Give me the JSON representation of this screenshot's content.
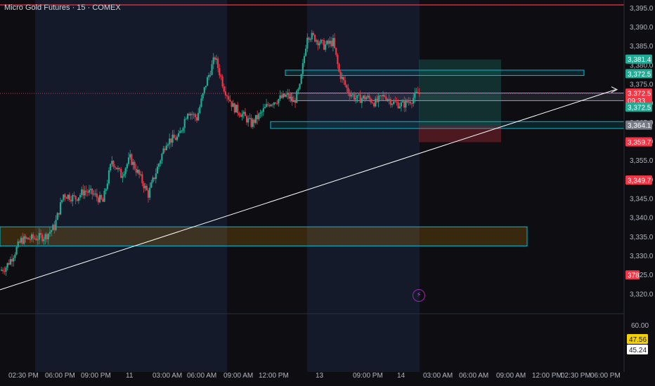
{
  "header": {
    "title": "Micro Gold Futures · 15 · COMEX"
  },
  "chart_data": {
    "type": "candlestick",
    "symbol": "Micro Gold Futures",
    "interval": "15",
    "exchange": "COMEX",
    "ylim": [
      3316,
      3397
    ],
    "y_ticks": [
      3320,
      3325,
      3330,
      3335,
      3340,
      3345,
      3350,
      3355,
      3360,
      3365,
      3370,
      3375,
      3380,
      3385,
      3390,
      3395
    ],
    "x_tick_labels": [
      "02:30 PM",
      "06:00 PM",
      "09:00 PM",
      "11",
      "03:00 AM",
      "06:00 AM",
      "09:00 AM",
      "12:00 PM",
      "13",
      "09:00 PM",
      "14",
      "03:00 AM",
      "06:00 AM",
      "09:00 AM",
      "12:00 PM",
      "02:30 PM",
      "06:00 PM"
    ],
    "price_path": [
      [
        0,
        3326.0
      ],
      [
        4,
        3327.0
      ],
      [
        8,
        3329.5
      ],
      [
        14,
        3334.0
      ],
      [
        22,
        3334.5
      ],
      [
        30,
        3335.0
      ],
      [
        36,
        3337.5
      ],
      [
        42,
        3346.0
      ],
      [
        50,
        3345.0
      ],
      [
        56,
        3347.0
      ],
      [
        62,
        3346.0
      ],
      [
        68,
        3344.0
      ],
      [
        74,
        3355.0
      ],
      [
        80,
        3351.0
      ],
      [
        86,
        3355.5
      ],
      [
        92,
        3351.0
      ],
      [
        98,
        3346.0
      ],
      [
        104,
        3353.0
      ],
      [
        110,
        3360.0
      ],
      [
        118,
        3361.0
      ],
      [
        124,
        3368.0
      ],
      [
        130,
        3366.0
      ],
      [
        136,
        3375.0
      ],
      [
        142,
        3382.0
      ],
      [
        148,
        3374.0
      ],
      [
        154,
        3369.0
      ],
      [
        160,
        3367.0
      ],
      [
        166,
        3364.5
      ],
      [
        172,
        3367.0
      ],
      [
        178,
        3370.0
      ],
      [
        184,
        3371.0
      ],
      [
        190,
        3372.0
      ],
      [
        194,
        3370.0
      ],
      [
        198,
        3374.0
      ],
      [
        203,
        3388.0
      ],
      [
        208,
        3387.0
      ],
      [
        214,
        3385.0
      ],
      [
        220,
        3386.0
      ],
      [
        224,
        3378.0
      ],
      [
        230,
        3373.0
      ],
      [
        236,
        3371.0
      ],
      [
        242,
        3371.5
      ],
      [
        248,
        3370.0
      ],
      [
        254,
        3372.0
      ],
      [
        260,
        3370.0
      ],
      [
        266,
        3369.5
      ],
      [
        272,
        3371.0
      ],
      [
        276,
        3372.5
      ]
    ],
    "last_price": 3372.5,
    "price_labels": [
      {
        "text": "3,381.4",
        "value": 3381.4,
        "color": "#22ab94"
      },
      {
        "text": "3,372.5",
        "value": 3377.6,
        "color": "#22ab94"
      },
      {
        "text": "3,372.5",
        "value": 3372.5,
        "color": "#f23645"
      },
      {
        "text": "09:33",
        "value": 3370.6,
        "color": "#f23645"
      },
      {
        "text": "3,372.5",
        "value": 3368.8,
        "color": "#22ab94"
      },
      {
        "text": "3,364.1",
        "value": 3364.1,
        "color": "#787b86"
      },
      {
        "text": "3,359.7",
        "value": 3359.7,
        "color": "#f23645"
      },
      {
        "text": "3,349.7",
        "value": 3349.7,
        "color": "#f23645"
      },
      {
        "text": "378",
        "value": 3324.8,
        "color": "#f23645"
      }
    ],
    "zones": [
      {
        "name": "demand-zone",
        "from": 3332.5,
        "to": 3337.5,
        "color": "#f7a600"
      },
      {
        "name": "resistance-zone",
        "from": 3377.2,
        "to": 3378.6,
        "color": "#00bcd4"
      },
      {
        "name": "entry-zone",
        "from": 3370.6,
        "to": 3372.6,
        "color": "#9c9cc0"
      },
      {
        "name": "support-zone",
        "from": 3363.3,
        "to": 3365.1,
        "color": "#00bcd4"
      }
    ],
    "position": {
      "entry": 3364.1,
      "target": 3381.4,
      "stop": 3359.7
    },
    "trendline": {
      "from": 3321.0,
      "to": 3373.5,
      "color": "#ffffff"
    },
    "indicator": {
      "ticks": [
        60.0
      ],
      "values": [
        47.56,
        45.24
      ],
      "colors": [
        "#f5d000",
        "#ffffff"
      ]
    },
    "grid": false,
    "colors": {
      "up": "#22ab94",
      "down": "#f23645",
      "background": "#0e0e12",
      "session": "#141a2a",
      "axis_text": "#b2b5be"
    }
  }
}
